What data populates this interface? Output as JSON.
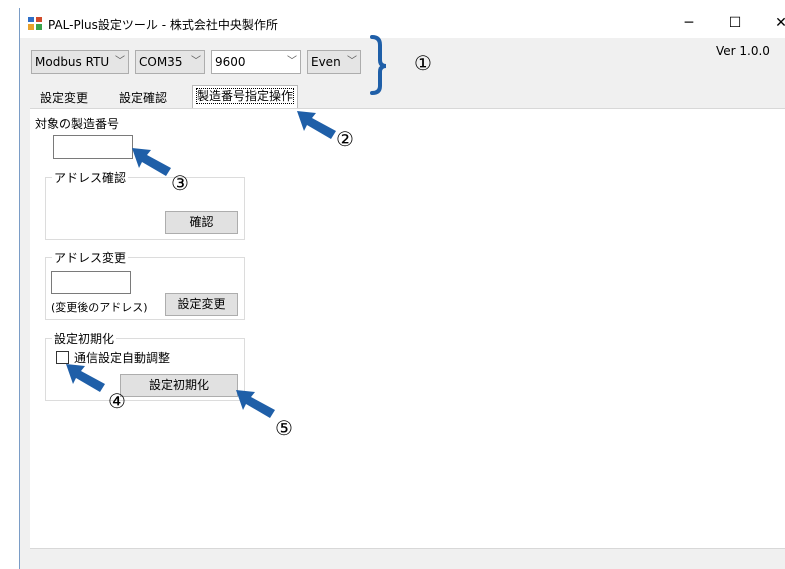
{
  "window": {
    "title": "PAL-Plus設定ツール - 株式会社中央製作所",
    "minimize": "─",
    "maximize": "☐",
    "close": "✕"
  },
  "version": "Ver 1.0.0",
  "toolbar": {
    "protocol": "Modbus RTU",
    "port": "COM35",
    "baud": "9600",
    "parity": "Even"
  },
  "tabs": [
    "設定変更",
    "設定確認",
    "製造番号指定操作"
  ],
  "target": {
    "label": "対象の製造番号",
    "value": ""
  },
  "address_check": {
    "title": "アドレス確認",
    "button": "確認"
  },
  "address_change": {
    "title": "アドレス変更",
    "value": "",
    "hint": "(変更後のアドレス)",
    "button": "設定変更"
  },
  "init": {
    "title": "設定初期化",
    "checkbox_label": "通信設定自動調整",
    "checked": false,
    "button": "設定初期化"
  },
  "callouts": [
    "①",
    "②",
    "③",
    "④",
    "⑤"
  ],
  "colors": {
    "accent": "#1f5fa8",
    "window_bg": "#f0f0f0"
  }
}
